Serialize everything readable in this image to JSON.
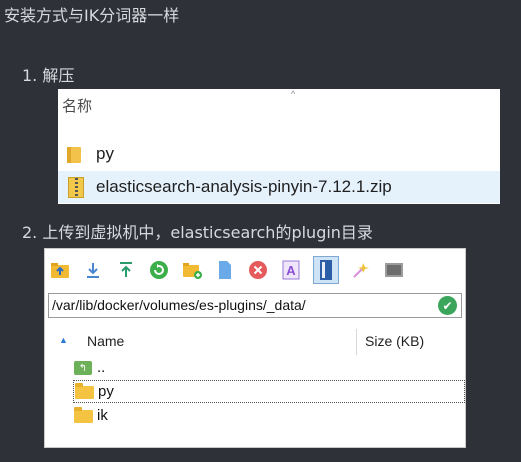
{
  "heading": "安装方式与IK分词器一样",
  "steps": {
    "step1": "1. 解压",
    "step2": "2. 上传到虚拟机中，elasticsearch的plugin目录"
  },
  "explorer": {
    "column_header": "名称",
    "files": [
      {
        "name": "py",
        "icon": "folder-icon"
      },
      {
        "name": "elasticsearch-analysis-pinyin-7.12.1.zip",
        "icon": "zip-archive-icon",
        "selected": true
      }
    ]
  },
  "client": {
    "toolbar_icons": [
      "parent-dir-icon",
      "download-icon",
      "upload-icon",
      "refresh-icon",
      "new-folder-icon",
      "new-file-icon",
      "delete-icon",
      "rename-icon",
      "split-view-icon",
      "tools-icon",
      "terminal-icon"
    ],
    "path": "/var/lib/docker/volumes/es-plugins/_data/",
    "columns": {
      "name": "Name",
      "size": "Size (KB)"
    },
    "items": [
      {
        "name": "..",
        "icon": "parent-folder-icon"
      },
      {
        "name": "py",
        "icon": "folder-icon",
        "focused": true
      },
      {
        "name": "ik",
        "icon": "folder-icon"
      }
    ]
  },
  "colors": {
    "background": "#2e3238",
    "selection": "#e5f1fb",
    "folder": "#f4c342",
    "ok_green": "#3aa55b"
  }
}
